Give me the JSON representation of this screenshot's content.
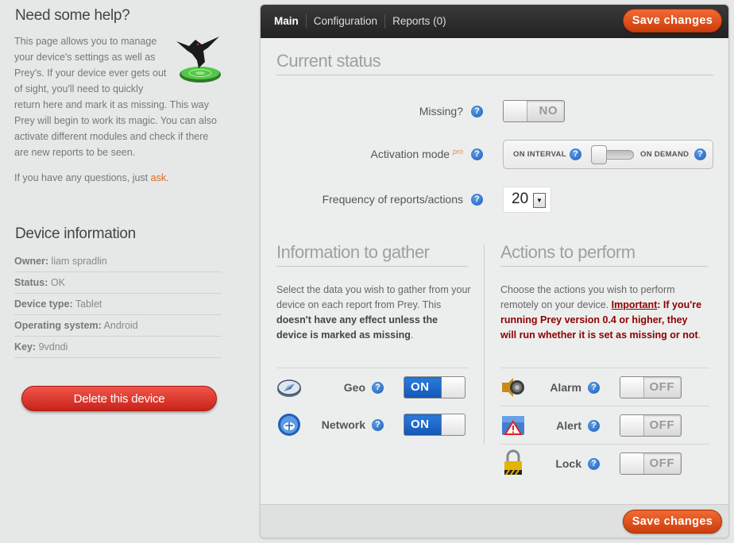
{
  "sidebar": {
    "help_title": "Need some help?",
    "help_text": "This page allows you to manage your device's settings as well as Prey's. If your device ever gets out of sight, you'll need to quickly return here and mark it as missing. This way Prey will begin to work its magic. You can also activate different modules and check if there are new reports to be seen.",
    "ask_prefix": "If you have any questions, just ",
    "ask_link": "ask",
    "ask_suffix": ".",
    "device_title": "Device information",
    "device": [
      {
        "label": "Owner:",
        "value": "liam spradlin"
      },
      {
        "label": "Status:",
        "value": "OK"
      },
      {
        "label": "Device type:",
        "value": "Tablet"
      },
      {
        "label": "Operating system:",
        "value": "Android"
      },
      {
        "label": "Key:",
        "value": "9vdndi"
      }
    ],
    "delete_label": "Delete this device"
  },
  "topbar": {
    "tabs": [
      "Main",
      "Configuration",
      "Reports (0)"
    ],
    "save_label": "Save changes"
  },
  "status": {
    "title": "Current status",
    "missing_label": "Missing?",
    "missing_value": "NO",
    "activation_label": "Activation mode",
    "pro_badge": "pro",
    "on_interval": "ON INTERVAL",
    "on_demand": "ON DEMAND",
    "frequency_label": "Frequency of reports/actions",
    "frequency_value": "20"
  },
  "gather": {
    "title": "Information to gather",
    "text_a": "Select the data you wish to gather from your device on each report from Prey. This ",
    "text_b": "doesn't have any effect unless the device is marked as missing",
    "text_c": ".",
    "modules": [
      {
        "name": "Geo",
        "value": "ON",
        "icon": "compass-icon"
      },
      {
        "name": "Network",
        "value": "ON",
        "icon": "network-globe-icon"
      }
    ]
  },
  "actions": {
    "title": "Actions to perform",
    "text_a": "Choose the actions you wish to perform remotely on your device. ",
    "important": "Important",
    "text_b": ": If you're running Prey version 0.4 or higher, they will run whether it is set as missing or not",
    "text_c": ".",
    "modules": [
      {
        "name": "Alarm",
        "value": "OFF",
        "icon": "speaker-icon"
      },
      {
        "name": "Alert",
        "value": "OFF",
        "icon": "alert-sign-icon"
      },
      {
        "name": "Lock",
        "value": "OFF",
        "icon": "padlock-icon"
      }
    ]
  },
  "hint_glyph": "?",
  "colors": {
    "accent": "#e0681f",
    "save": "#d9461a",
    "delete": "#d42c22",
    "toggle_on": "#1e6cd0"
  }
}
